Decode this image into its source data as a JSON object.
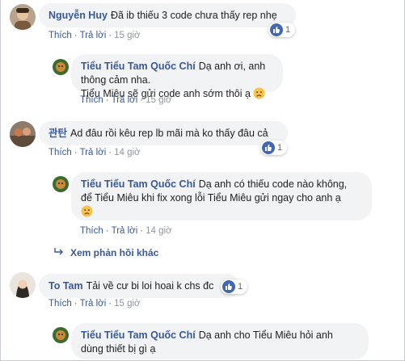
{
  "comments": [
    {
      "author": "Nguyễn Huy",
      "text": "Đã ib thiếu 3 code chưa thấy rep nhẹ",
      "like_count": "1",
      "actions": {
        "like": "Thích",
        "reply": "Trả lời",
        "time": "15 giờ"
      },
      "reply": {
        "author": "Tiểu Tiểu Tam Quốc Chí",
        "line1": "Dạ anh ơi, anh thông cảm nha.",
        "line2": "Tiểu Miêu sẽ gửi code anh sớm thôi ạ",
        "actions": {
          "like": "Thích",
          "reply": "Trả lời",
          "time": "15 giờ"
        }
      }
    },
    {
      "author": "관탄",
      "text": "Ad đâu rồi kêu rep lb mãi mà ko thấy đâu cả",
      "like_count": "1",
      "actions": {
        "like": "Thích",
        "reply": "Trả lời",
        "time": "14 giờ"
      },
      "reply": {
        "author": "Tiểu Tiểu Tam Quốc Chí",
        "line1": "Dạ anh có thiếu code nào không,",
        "line2": "để Tiểu Miêu khi fix xong lỗi Tiểu Miêu gửi ngay cho anh ạ",
        "actions": {
          "like": "Thích",
          "reply": "Trả lời",
          "time": "14 giờ"
        }
      },
      "more_replies": "Xem phản hồi khác"
    },
    {
      "author": "To Tam",
      "text": "Tải về cư bi loi hoai k chs đc",
      "like_count": "1",
      "actions": {
        "like": "Thích",
        "reply": "Trả lời",
        "time": "15 giờ"
      },
      "reply": {
        "author": "Tiểu Tiểu Tam Quốc Chí",
        "line1": "Dạ anh cho Tiểu Miêu hỏi anh",
        "line2": "dùng thiết bị gì ạ"
      }
    }
  ],
  "colors": {
    "link": "#385898",
    "bubble": "#f2f3f5",
    "like": "#4267b2"
  },
  "icons": [
    "thumbs-up-icon",
    "sad-face-icon",
    "reply-arrow-icon"
  ]
}
